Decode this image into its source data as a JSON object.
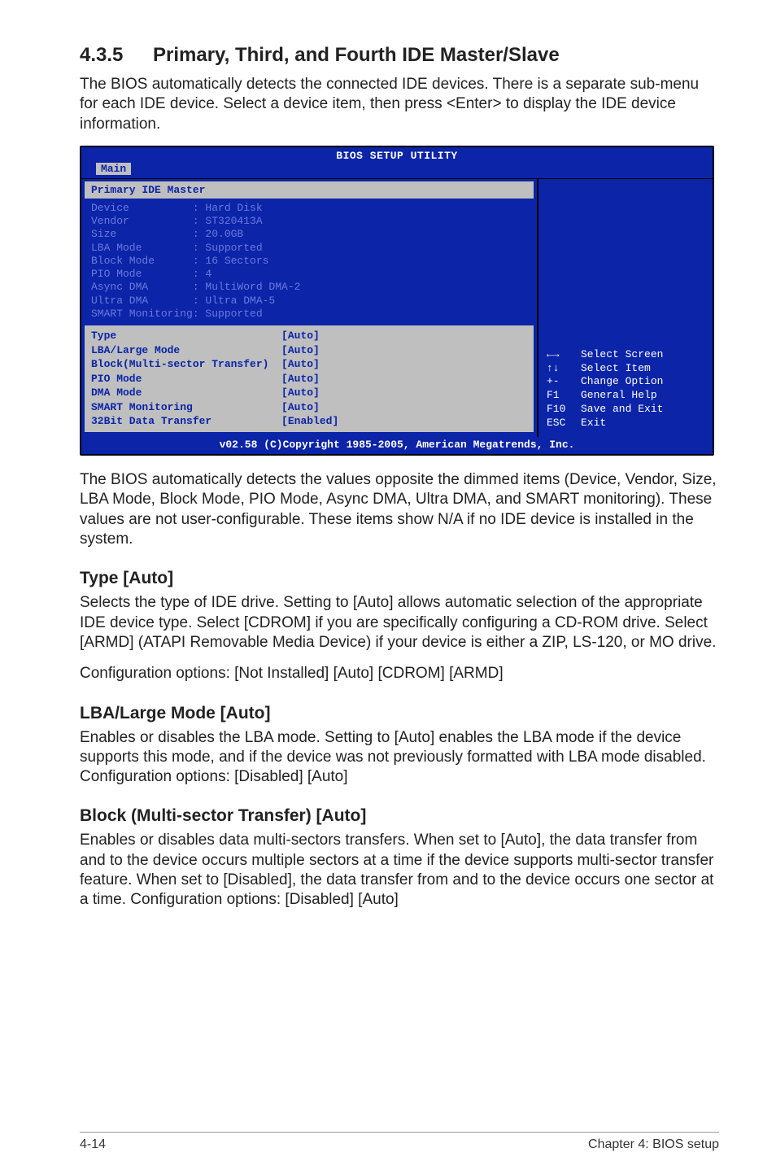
{
  "section": {
    "number": "4.3.5",
    "title": "Primary, Third, and Fourth IDE Master/Slave"
  },
  "intro": "The BIOS automatically detects the connected IDE devices. There is a separate sub-menu for each IDE device. Select a device item, then press <Enter> to display the IDE device information.",
  "bios": {
    "title": "BIOS SETUP UTILITY",
    "tab": "Main",
    "section_title": "Primary IDE Master",
    "dim_rows": [
      [
        "Device",
        "Hard Disk"
      ],
      [
        "Vendor",
        "ST320413A"
      ],
      [
        "Size",
        "20.0GB"
      ],
      [
        "LBA Mode",
        "Supported"
      ],
      [
        "Block Mode",
        "16 Sectors"
      ],
      [
        "PIO Mode",
        "4"
      ],
      [
        "Async DMA",
        "MultiWord DMA-2"
      ],
      [
        "Ultra DMA",
        "Ultra DMA-5"
      ],
      [
        "SMART Monitoring",
        "Supported"
      ]
    ],
    "options": [
      [
        "Type",
        "[Auto]"
      ],
      [
        "LBA/Large Mode",
        "[Auto]"
      ],
      [
        "Block(Multi-sector Transfer)",
        "[Auto]"
      ],
      [
        "PIO Mode",
        "[Auto]"
      ],
      [
        "DMA Mode",
        "[Auto]"
      ],
      [
        "SMART Monitoring",
        "[Auto]"
      ],
      [
        "32Bit Data Transfer",
        "[Enabled]"
      ]
    ],
    "hints": [
      [
        "←→",
        "Select Screen"
      ],
      [
        "↑↓",
        "Select Item"
      ],
      [
        "+-",
        "Change Option"
      ],
      [
        "F1",
        "General Help"
      ],
      [
        "F10",
        "Save and Exit"
      ],
      [
        "ESC",
        "Exit"
      ]
    ],
    "copyright": "v02.58 (C)Copyright 1985-2005, American Megatrends, Inc."
  },
  "after_bios": "The BIOS automatically detects the values opposite the dimmed items (Device, Vendor, Size, LBA Mode, Block Mode, PIO Mode, Async DMA, Ultra DMA, and SMART monitoring). These values are not user-configurable. These items show N/A if no IDE device is installed in the system.",
  "type": {
    "heading": "Type [Auto]",
    "p1": "Selects the type of IDE drive. Setting to [Auto] allows automatic selection of the appropriate IDE device type. Select [CDROM] if you are specifically configuring a CD-ROM drive. Select [ARMD] (ATAPI Removable Media Device) if your device is either a ZIP, LS-120, or MO drive.",
    "p2": "Configuration options: [Not Installed] [Auto] [CDROM] [ARMD]"
  },
  "lba": {
    "heading": "LBA/Large Mode [Auto]",
    "p1": "Enables or disables the LBA mode. Setting to [Auto] enables the LBA mode if the device supports this mode, and if the device was not previously formatted with LBA mode disabled. Configuration options: [Disabled] [Auto]"
  },
  "block": {
    "heading": "Block (Multi-sector Transfer) [Auto]",
    "p1": "Enables or disables data multi-sectors transfers. When set to [Auto], the data transfer from and to the device occurs multiple sectors at a time if the device supports multi-sector transfer feature. When set to [Disabled], the data transfer from and to the device occurs one sector at a time. Configuration options: [Disabled] [Auto]"
  },
  "footer": {
    "left": "4-14",
    "right": "Chapter 4: BIOS setup"
  }
}
